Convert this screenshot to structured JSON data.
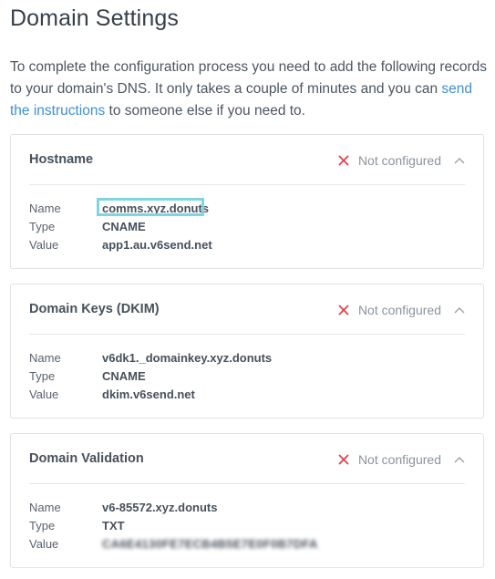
{
  "page": {
    "title": "Domain Settings",
    "intro_text_before": "To complete the configuration process you need to add the following records to your domain's DNS. It only takes a couple of minutes and you can ",
    "intro_link": "send the instructions",
    "intro_text_after": " to someone else if you need to."
  },
  "cards": [
    {
      "title": "Hostname",
      "status": "Not configured",
      "rows": [
        {
          "key": "Name",
          "value": "comms.xyz.donuts"
        },
        {
          "key": "Type",
          "value": "CNAME"
        },
        {
          "key": "Value",
          "value": "app1.au.v6send.net"
        }
      ]
    },
    {
      "title": "Domain Keys (DKIM)",
      "status": "Not configured",
      "rows": [
        {
          "key": "Name",
          "value": "v6dk1._domainkey.xyz.donuts"
        },
        {
          "key": "Type",
          "value": "CNAME"
        },
        {
          "key": "Value",
          "value": "dkim.v6send.net"
        }
      ]
    },
    {
      "title": "Domain Validation",
      "status": "Not configured",
      "rows": [
        {
          "key": "Name",
          "value": "v6-85572.xyz.donuts"
        },
        {
          "key": "Type",
          "value": "TXT"
        },
        {
          "key": "Value",
          "value": "CA6E4130FE7ECB4B5E7E0F0B7DFA"
        }
      ]
    }
  ],
  "colors": {
    "link": "#3d8fd8",
    "status_x": "#e2414d",
    "highlight": "#7fd5df"
  },
  "icons": {
    "status": "close-icon",
    "toggle": "chevron-up-icon"
  }
}
